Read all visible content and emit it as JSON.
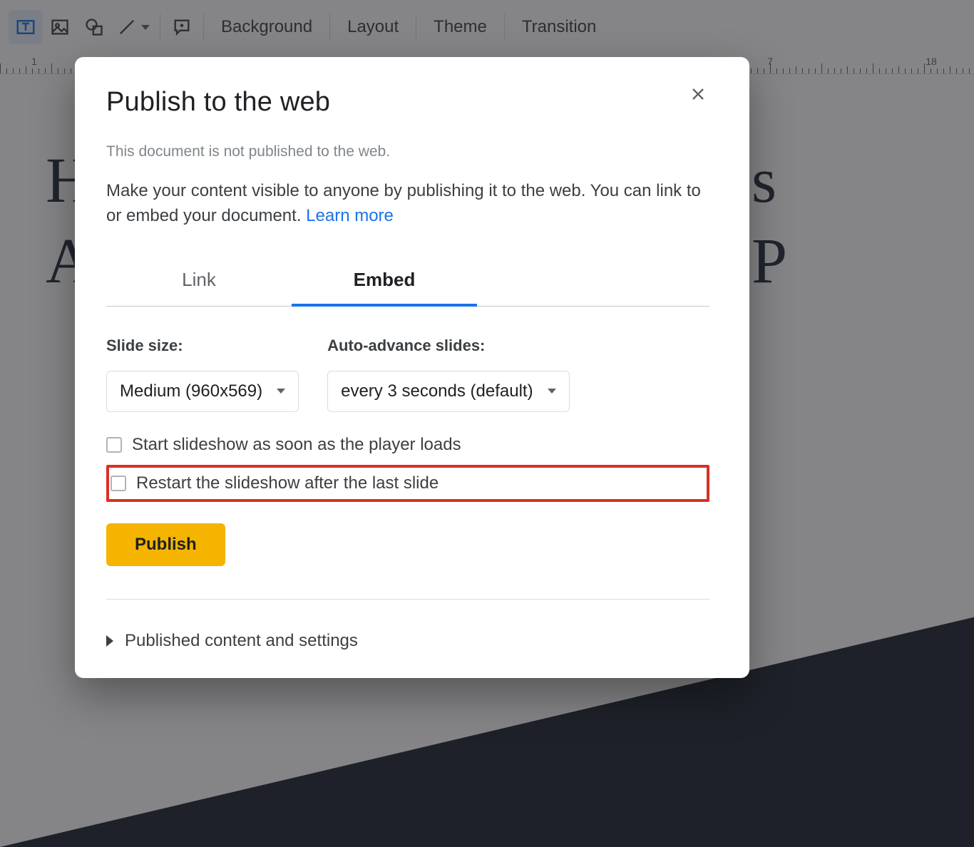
{
  "toolbar": {
    "items": [
      "Background",
      "Layout",
      "Theme",
      "Transition"
    ]
  },
  "ruler": {
    "labels": [
      "1",
      "7",
      "18"
    ]
  },
  "slide": {
    "line1": "H",
    "line1_suffix": "s P",
    "line2": "A"
  },
  "dialog": {
    "title": "Publish to the web",
    "status": "This document is not published to the web.",
    "description_prefix": "Make your content visible to anyone by publishing it to the web. You can link to or embed your document. ",
    "learn_more": "Learn more",
    "tabs": {
      "link": "Link",
      "embed": "Embed"
    },
    "slide_size": {
      "label": "Slide size:",
      "value": "Medium (960x569)"
    },
    "auto_advance": {
      "label": "Auto-advance slides:",
      "value": "every 3 seconds (default)"
    },
    "check_start": "Start slideshow as soon as the player loads",
    "check_restart": "Restart the slideshow after the last slide",
    "publish_button": "Publish",
    "expander": "Published content and settings"
  }
}
